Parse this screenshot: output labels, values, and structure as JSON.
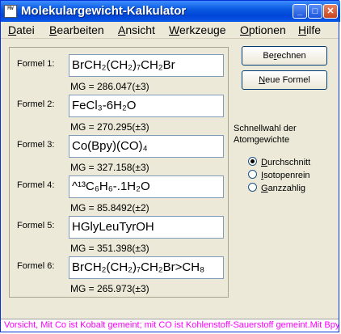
{
  "window": {
    "title": "Molekulargewicht-Kalkulator",
    "icon_text": "MW",
    "controls": {
      "minimize": "_",
      "maximize": "□",
      "close": "✕"
    }
  },
  "menu": {
    "items": [
      {
        "label": "Datei",
        "accel": "D",
        "rest": "atei"
      },
      {
        "label": "Bearbeiten",
        "accel": "B",
        "rest": "earbeiten"
      },
      {
        "label": "Ansicht",
        "accel": "A",
        "rest": "nsicht"
      },
      {
        "label": "Werkzeuge",
        "accel": "W",
        "rest": "erkzeuge"
      },
      {
        "label": "Optionen",
        "accel": "O",
        "rest": "ptionen"
      },
      {
        "label": "Hilfe",
        "accel": "H",
        "rest": "ilfe"
      }
    ]
  },
  "formulas": [
    {
      "label": "Formel 1:",
      "value": "BrCH₂(CH₂)₇CH₂Br",
      "mg": "MG = 286.047(±3)"
    },
    {
      "label": "Formel 2:",
      "value": "FeCl₃-6H₂O",
      "mg": "MG = 270.295(±3)"
    },
    {
      "label": "Formel 3:",
      "value": "Co(Bpy)(CO)₄",
      "mg": "MG = 327.158(±3)"
    },
    {
      "label": "Formel 4:",
      "value": "^¹³C₆H₆-.1H₂O",
      "mg": "MG = 85.8492(±2)"
    },
    {
      "label": "Formel 5:",
      "value": "HGlyLeuTyrOH",
      "mg": "MG = 351.398(±3)"
    },
    {
      "label": "Formel 6:",
      "value": "BrCH₂(CH₂)₇CH₂Br>CH₈",
      "mg": "MG = 265.973(±3)"
    }
  ],
  "buttons": {
    "calculate": {
      "pre": "Be",
      "accel": "r",
      "post": "echnen"
    },
    "new_formula": {
      "pre": "",
      "accel": "N",
      "post": "eue Formel"
    }
  },
  "quick_select": {
    "title_line1": "Schnellwahl der",
    "title_line2": "Atomgewichte",
    "options": [
      {
        "accel": "D",
        "rest": "urchschnitt",
        "checked": true
      },
      {
        "accel": "I",
        "rest": "sotopenrein",
        "checked": false
      },
      {
        "accel": "G",
        "rest": "anzzahlig",
        "checked": false
      }
    ]
  },
  "status": "Vorsicht, Mit Co ist Kobalt gemeint; mit CO ist Kohlenstoff-Sauerstoff gemeint.Mit Bpy ist",
  "colors": {
    "status_text": "#ff00ff",
    "titlebar": "#0a5be0",
    "window_bg": "#ece9d8"
  }
}
